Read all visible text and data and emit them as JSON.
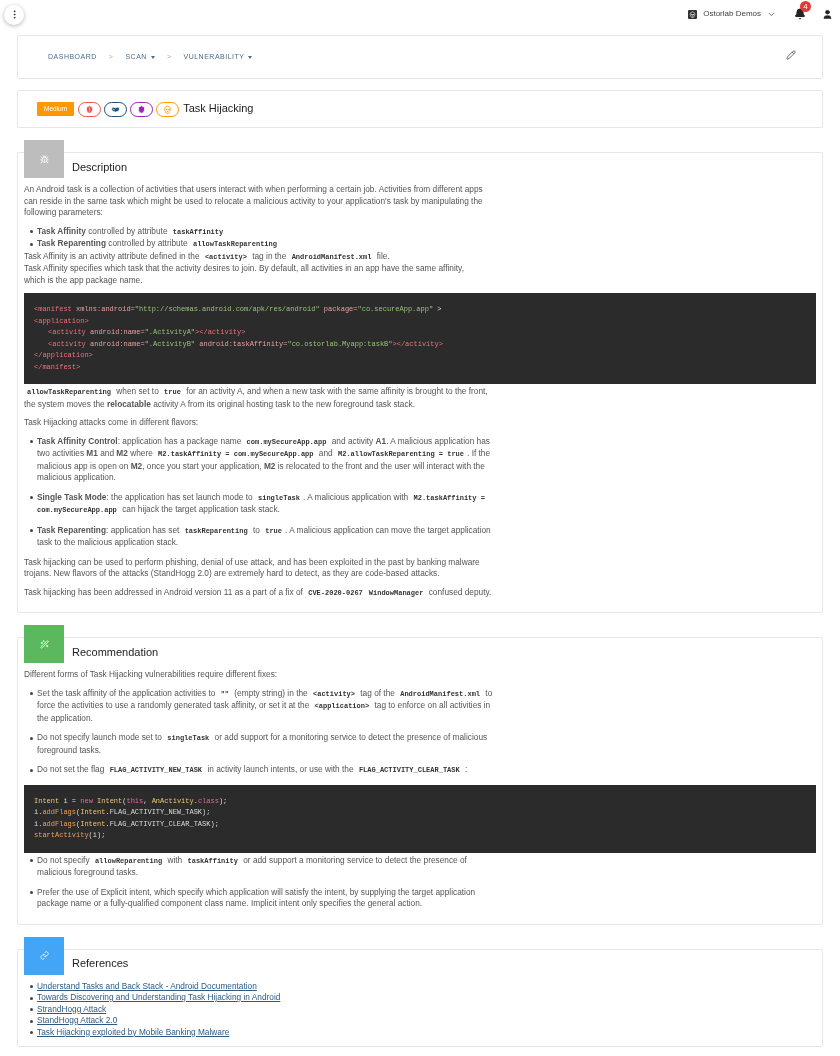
{
  "topbar": {
    "workspace": "Ostorlab Demos",
    "notification_count": "4"
  },
  "breadcrumb": {
    "separator": ">",
    "items": [
      {
        "label": "DASHBOARD",
        "dropdown": false
      },
      {
        "label": "SCAN",
        "dropdown": true
      },
      {
        "label": "VULNERABILITY",
        "dropdown": true
      }
    ]
  },
  "vulnerability": {
    "severity": "Medium",
    "title": "Task Hijacking",
    "tags": [
      {
        "kind": "shield-alert",
        "color": "#ef5350"
      },
      {
        "kind": "mask",
        "color": "#1f4e79"
      },
      {
        "kind": "shield",
        "color": "#9c27b0"
      },
      {
        "kind": "skull",
        "color": "#ff9800"
      }
    ]
  },
  "sections": [
    {
      "kind": "description",
      "title": "Description",
      "color": "#bdbdbd",
      "blocks": [
        {
          "kind": "paragraph",
          "segments": [
            "An Android task is a collection of activities that users interact with when performing a certain job. Activities from different apps can reside in the same task which might be used to relocate a malicious activity to your application's task by manipulating the following parameters:"
          ]
        },
        {
          "kind": "list",
          "spaced": false,
          "items": [
            [
              "**Task Affinity** controlled by attribute ",
              {
                "code": "taskAffinity"
              }
            ],
            [
              "**Task Reparenting** controlled by attribute ",
              {
                "code": "allowTaskReparenting"
              }
            ]
          ]
        },
        {
          "kind": "lines",
          "lines": [
            [
              "Task Affinity is an activity attribute defined in the ",
              {
                "code": "<activity>"
              },
              " tag in the ",
              {
                "code": "AndroidManifest.xml"
              },
              " file."
            ],
            [
              "Task Affinity specifies which task that the activity desires to join. By default, all activities in an app have the same affinity, which is the app package name."
            ]
          ]
        },
        {
          "kind": "code",
          "lines": [
            {
              "indent": false,
              "tokens": [
                {
                  "kind": "tag",
                  "text": "<manifest"
                },
                {
                  "kind": "attr",
                  "text": " xmlns:android="
                },
                {
                  "kind": "string",
                  "text": "\"http://schemas.android.com/apk/res/android\""
                },
                {
                  "kind": "attr",
                  "text": " package="
                },
                {
                  "kind": "string",
                  "text": "\"co.secureApp.app\""
                },
                {
                  "kind": "plain",
                  "text": " >"
                }
              ]
            },
            {
              "indent": false,
              "tokens": [
                {
                  "kind": "tag",
                  "text": "<application>"
                }
              ]
            },
            {
              "indent": true,
              "tokens": [
                {
                  "kind": "tag",
                  "text": "<activity"
                },
                {
                  "kind": "attr",
                  "text": " android:name="
                },
                {
                  "kind": "string",
                  "text": "\".ActivityA\""
                },
                {
                  "kind": "tag",
                  "text": "></activity>"
                }
              ]
            },
            {
              "indent": true,
              "tokens": [
                {
                  "kind": "tag",
                  "text": "<activity"
                },
                {
                  "kind": "attr",
                  "text": " android:name="
                },
                {
                  "kind": "string",
                  "text": "\".ActivityB\""
                },
                {
                  "kind": "attr",
                  "text": " android:taskAffinity="
                },
                {
                  "kind": "string",
                  "text": "\"co.ostorlab.Myapp:taskB\""
                },
                {
                  "kind": "tag",
                  "text": "></activity>"
                }
              ]
            },
            {
              "indent": false,
              "tokens": [
                {
                  "kind": "tag",
                  "text": "</application>"
                }
              ]
            },
            {
              "indent": false,
              "tokens": [
                {
                  "kind": "tag",
                  "text": "</manifest>"
                }
              ]
            }
          ]
        },
        {
          "kind": "paragraph",
          "segments": [
            {
              "code": "allowTaskReparenting"
            },
            " when set to ",
            {
              "code": "true"
            },
            " for an activity A, and when a new task with the same affinity is brought to the front, the system moves the **relocatable** activity A from its original hosting task to the new foreground task stack."
          ]
        },
        {
          "kind": "paragraph",
          "segments": [
            "Task Hijacking attacks come in different flavors:"
          ]
        },
        {
          "kind": "list",
          "spaced": true,
          "items": [
            [
              "**Task Affinity Control**: application has a package name ",
              {
                "code": "com.mySecureApp.app"
              },
              " and activity **A1**. A malicious application has two activities **M1** and **M2** where ",
              {
                "code": "M2.taskAffinity = com.mySecureApp.app"
              },
              " and ",
              {
                "code": "M2.allowTaskReparenting = true"
              },
              ". If the malicious app is open on **M2**, once you start your application, **M2** is relocated to the front and the user will interact with the malicious application."
            ],
            [
              "**Single Task Mode**: the application has set launch mode to ",
              {
                "code": "singleTask"
              },
              ". A malicious application with ",
              {
                "code": "M2.taskAffinity = com.mySecureApp.app"
              },
              " can hijack the target application task stack."
            ],
            [
              "**Task Reparenting**: application has set ",
              {
                "code": "taskReparenting"
              },
              " to ",
              {
                "code": "true"
              },
              ". A malicious application can move the target application task to the malicious application stack."
            ]
          ]
        },
        {
          "kind": "paragraph",
          "segments": [
            "Task hijacking can be used to perform phishing, denial of use attack, and has been exploited in the past by banking malware trojans. New flavors of the attacks (StandHogg 2.0) are extremely hard to detect, as they are code-based attacks."
          ]
        },
        {
          "kind": "paragraph",
          "segments": [
            "Task hijacking has been addressed in Android version 11 as a part of a fix of ",
            {
              "code": "CVE-2020-0267"
            },
            {
              "code": "WindowManager"
            },
            " confused deputy."
          ]
        }
      ]
    },
    {
      "kind": "recommendation",
      "title": "Recommendation",
      "color": "#5cb85c",
      "blocks": [
        {
          "kind": "paragraph",
          "segments": [
            "Different forms of Task Hijacking vulnerabilities require different fixes:"
          ]
        },
        {
          "kind": "list",
          "spaced": true,
          "items": [
            [
              "Set the task affinity of the application activities to ",
              {
                "code": "\"\""
              },
              " (empty string) in the ",
              {
                "code": "<activity>"
              },
              " tag of the ",
              {
                "code": "AndroidManifest.xml"
              },
              " to force the activities to use a randomly generated task affinity, or set it at the ",
              {
                "code": "<application>"
              },
              " tag to enforce on all activities in the application."
            ],
            [
              "Do not specify launch mode set to ",
              {
                "code": "singleTask"
              },
              " or add support for a monitoring service to detect the presence of malicious foreground tasks."
            ],
            [
              "Do not set the flag ",
              {
                "code": "FLAG_ACTIVITY_NEW_TASK"
              },
              " in activity launch intents, or use with the ",
              {
                "code": "FLAG_ACTIVITY_CLEAR_TASK"
              },
              " :"
            ]
          ]
        },
        {
          "kind": "code",
          "lines": [
            {
              "indent": false,
              "tokens": [
                {
                  "kind": "type",
                  "text": "Intent"
                },
                {
                  "kind": "plain",
                  "text": " i = "
                },
                {
                  "kind": "keyword",
                  "text": "new"
                },
                {
                  "kind": "type",
                  "text": " Intent"
                },
                {
                  "kind": "plain",
                  "text": "("
                },
                {
                  "kind": "keyword",
                  "text": "this"
                },
                {
                  "kind": "plain",
                  "text": ", "
                },
                {
                  "kind": "type",
                  "text": "AnActivity"
                },
                {
                  "kind": "plain",
                  "text": "."
                },
                {
                  "kind": "keyword",
                  "text": "class"
                },
                {
                  "kind": "plain",
                  "text": ");"
                }
              ]
            },
            {
              "indent": false,
              "tokens": [
                {
                  "kind": "plain",
                  "text": "i."
                },
                {
                  "kind": "function",
                  "text": "addFlags"
                },
                {
                  "kind": "plain",
                  "text": "("
                },
                {
                  "kind": "type",
                  "text": "Intent"
                },
                {
                  "kind": "plain",
                  "text": ".FLAG_ACTIVITY_NEW_TASK);"
                }
              ]
            },
            {
              "indent": false,
              "tokens": [
                {
                  "kind": "plain",
                  "text": "i."
                },
                {
                  "kind": "function",
                  "text": "addFlags"
                },
                {
                  "kind": "plain",
                  "text": "("
                },
                {
                  "kind": "type",
                  "text": "Intent"
                },
                {
                  "kind": "plain",
                  "text": ".FLAG_ACTIVITY_CLEAR_TASK);"
                }
              ]
            },
            {
              "indent": false,
              "tokens": [
                {
                  "kind": "function",
                  "text": "startActivity"
                },
                {
                  "kind": "plain",
                  "text": "(i);"
                }
              ]
            }
          ]
        },
        {
          "kind": "list",
          "spaced": true,
          "items": [
            [
              "Do not specify ",
              {
                "code": "allowReparenting"
              },
              " with ",
              {
                "code": "taskAffinity"
              },
              " or add support a monitoring service to detect the presence of malicious foreground tasks."
            ],
            [
              "Prefer the use of Explicit intent, which specify which application will satisfy the intent, by supplying the target application package name or a fully-qualified component class name. Implicit intent only specifies the general action."
            ]
          ]
        }
      ]
    },
    {
      "kind": "references",
      "title": "References",
      "color": "#42a5f5",
      "blocks": [
        {
          "kind": "links",
          "items": [
            "Understand Tasks and Back Stack - Android Documentation",
            "Towards Discovering and Understanding Task Hijacking in Android",
            "StrandHogg Attack",
            "StandHogg Attack 2.0",
            "Task Hijacking exploited by Mobile Banking Malware"
          ]
        }
      ]
    }
  ]
}
